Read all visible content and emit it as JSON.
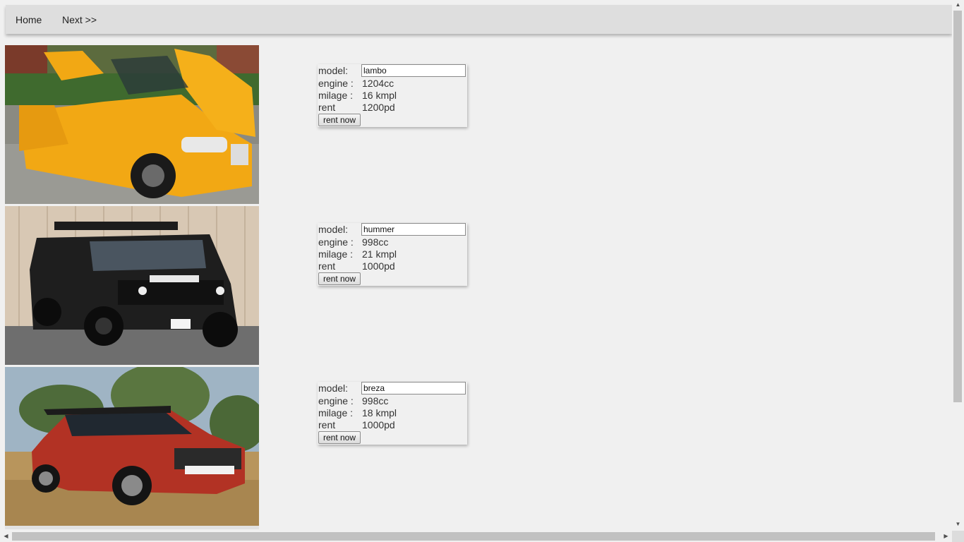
{
  "nav": {
    "home_label": "Home",
    "next_label": "Next >>"
  },
  "cars": [
    {
      "model_label": "model:",
      "model_value": "lambo",
      "engine_label": "engine :",
      "engine_value": "1204cc",
      "milage_label": "milage :",
      "milage_value": "16 kmpl",
      "rent_label": "rent",
      "rent_value": "1200pd",
      "button_label": "rent now",
      "photo": "yellow-convertible-car-photo"
    },
    {
      "model_label": "model:",
      "model_value": "hummer",
      "engine_label": "engine :",
      "engine_value": "998cc",
      "milage_label": "milage :",
      "milage_value": "21 kmpl",
      "rent_label": "rent",
      "rent_value": "1000pd",
      "button_label": "rent now",
      "photo": "black-suv-car-photo"
    },
    {
      "model_label": "model:",
      "model_value": "breza",
      "engine_label": "engine :",
      "engine_value": "998cc",
      "milage_label": "milage :",
      "milage_value": "18 kmpl",
      "rent_label": "rent",
      "rent_value": "1000pd",
      "button_label": "rent now",
      "photo": "red-compact-suv-car-photo"
    }
  ],
  "colors": {
    "page_background": "#f0f0f0",
    "nav_background": "#dedede",
    "scrollbar_thumb": "#c1c1c1"
  }
}
